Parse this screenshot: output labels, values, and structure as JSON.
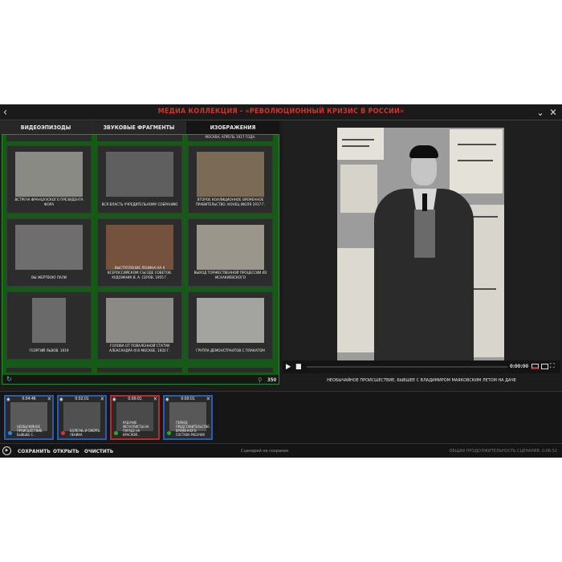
{
  "header": {
    "title": "МЕДИА КОЛЛЕКЦИЯ - «РЕВОЛЮЦИОННЫЙ КРИЗИС В РОССИИ»"
  },
  "tabs": [
    {
      "label": "ВИДЕОЭПИЗОДЫ"
    },
    {
      "label": "ЗВУКОВЫЕ ФРАГМЕНТЫ"
    },
    {
      "label": "ИЗОБРАЖЕНИЯ"
    }
  ],
  "gallery": {
    "partial_top_caption": "МОСКВА, АПРЕЛЬ 1917 ГОДА.",
    "items": [
      {
        "caption": "ВСТРЕЧА ФРАНЦУЗСКОГО ПРЕЗИДЕНТА ФОРА"
      },
      {
        "caption": "ВСЯ ВЛАСТЬ УЧРЕДИТЕЛЬНОМУ СОБРАНИЮ"
      },
      {
        "caption": "ВТОРОЕ КОАЛИЦИОННОЕ ВРЕМЕННОЕ ПРАВИТЕЛЬСТВО. КОНЕЦ ИЮЛЯ 1917 Г."
      },
      {
        "caption": "ВЫ ЖЕРТВОЮ ПАЛИ"
      },
      {
        "caption": "ВЫСТУПЛЕНИЕ ЛЕНИНА НА II ВСЕРОССИЙСКОМ СЪЕЗДЕ СОВЕТОВ. ХУДОЖНИК В. А. СЕРОВ. 1955 Г."
      },
      {
        "caption": "ВЫХОД ТОРЖЕСТВЕННОЙ ПРОЦЕССИИ ИЗ ИСААКИЕВСКОГО"
      },
      {
        "caption": "ГЕОРГИЙ ЛЬВОВ. 1919"
      },
      {
        "caption": "ГОЛОВА ОТ ПОВАЛЕННОЙ СТАТУИ АЛЕКСАНДРА III В МОСКВЕ. 1920 Г."
      },
      {
        "caption": "ГРУППА ДЕМОНСТРАНТОВ С ПЛАКАТОМ"
      }
    ],
    "count": "350"
  },
  "viewer": {
    "time": "0:00:00",
    "caption": "НЕОБЫЧАЙНОЕ ПРОИСШЕСТВИЕ, БЫВШЕЕ С ВЛАДИМИРОМ МАЯКОВСКИМ ЛЕТОМ НА ДАЧЕ"
  },
  "timeline": {
    "clips": [
      {
        "time": "0:04:46",
        "caption": "НЕОБЫЧАЙНОЕ ПРОИСШЕСТВИЕ, БЫВШЕЕ С...",
        "dot_color": "#2a8ad6",
        "border": "#2a5db0"
      },
      {
        "time": "0:02:01",
        "caption": "БОЛЕЗНЬ И СМЕРТЬ ЛЕНИНА",
        "dot_color": "#e03030",
        "border": "#2a5db0"
      },
      {
        "time": "0:00:01",
        "caption": "РАБОЧИЕ МЕТАЛЛИСТЫ НА ПАРАДЕ НА КРАСНОЙ...",
        "dot_color": "#20b020",
        "border": "#c0282f"
      },
      {
        "time": "0:00:01",
        "caption": "ПЕРВОЕ ПРЕДСТАВИТЕЛЬСТВО ВРЕМЕННОГО СОСТАВА РАБОЧИХ",
        "dot_color": "#20b020",
        "border": "#2a5db0"
      }
    ]
  },
  "bottombar": {
    "save": "СОХРАНИТЬ",
    "open": "ОТКРЫТЬ",
    "clear": "ОЧИСТИТЬ",
    "status": "Сценарий не сохранен",
    "duration": "ОБЩАЯ ПРОДОЛЖИТЕЛЬНОСТЬ СЦЕНАРИЯ: 0:06:52"
  },
  "colors": {
    "accent_red": "#d8302a",
    "gallery_green": "#155a17",
    "timeline_blue": "#2a5db0"
  }
}
